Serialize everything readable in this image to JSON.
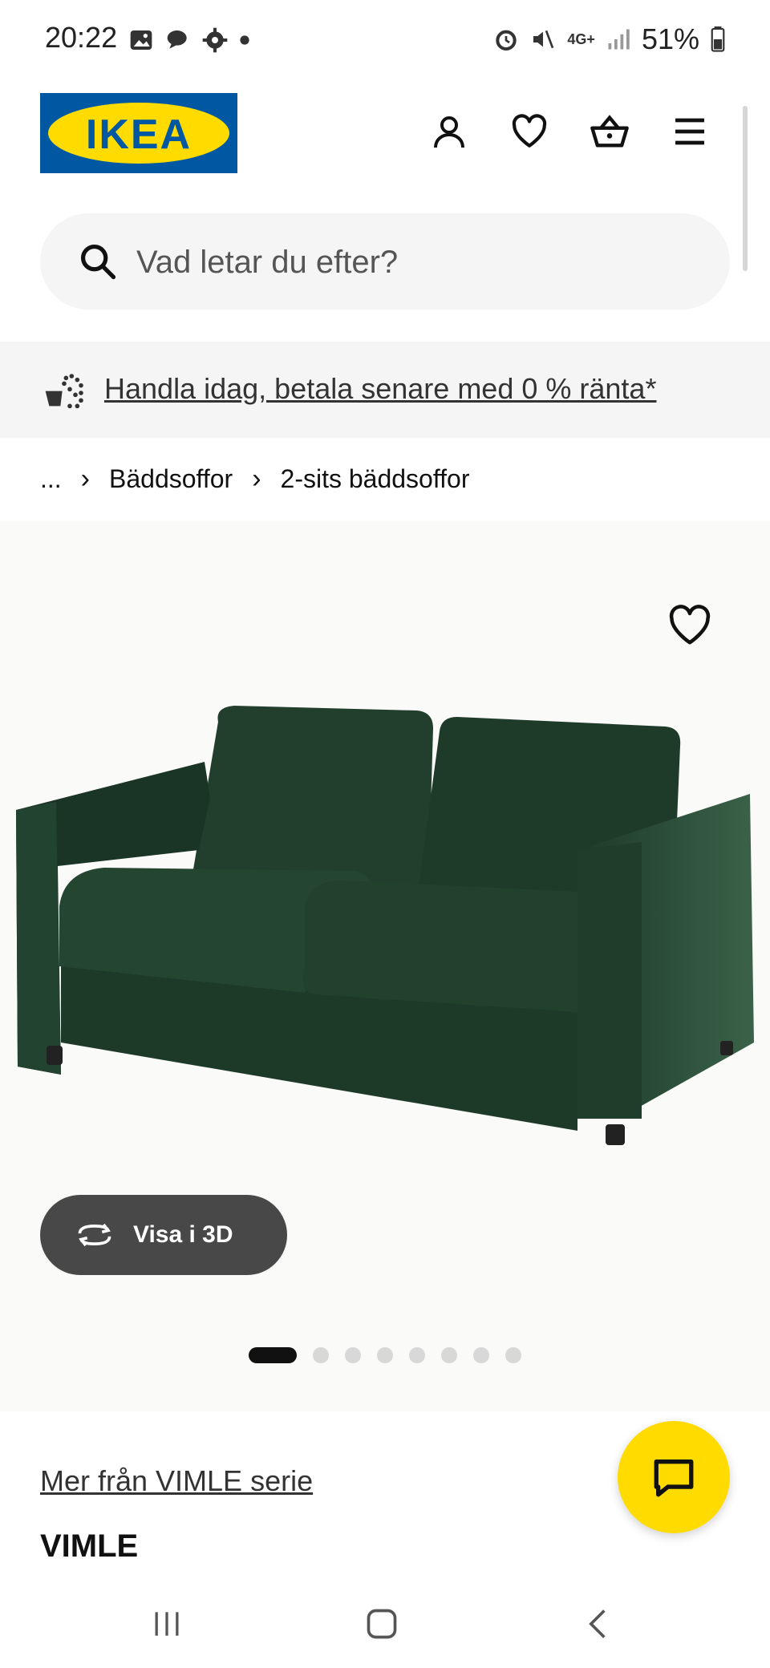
{
  "status_bar": {
    "time": "20:22",
    "network": "4G+",
    "battery": "51%"
  },
  "header": {
    "logo_text": "IKEA"
  },
  "search": {
    "placeholder": "Vad letar du efter?"
  },
  "promo": {
    "text": "Handla idag, betala senare med 0 % ränta*"
  },
  "breadcrumb": {
    "ellipsis": "...",
    "items": [
      "Bäddsoffor",
      "2-sits bäddsoffor"
    ]
  },
  "product": {
    "view3d_label": "Visa i 3D",
    "image_count": 8,
    "active_image": 1,
    "series_link": "Mer från VIMLE serie",
    "name": "VIMLE"
  },
  "colors": {
    "ikea_blue": "#0058a3",
    "ikea_yellow": "#ffdb00",
    "sofa_green": "#1f3d2a"
  }
}
